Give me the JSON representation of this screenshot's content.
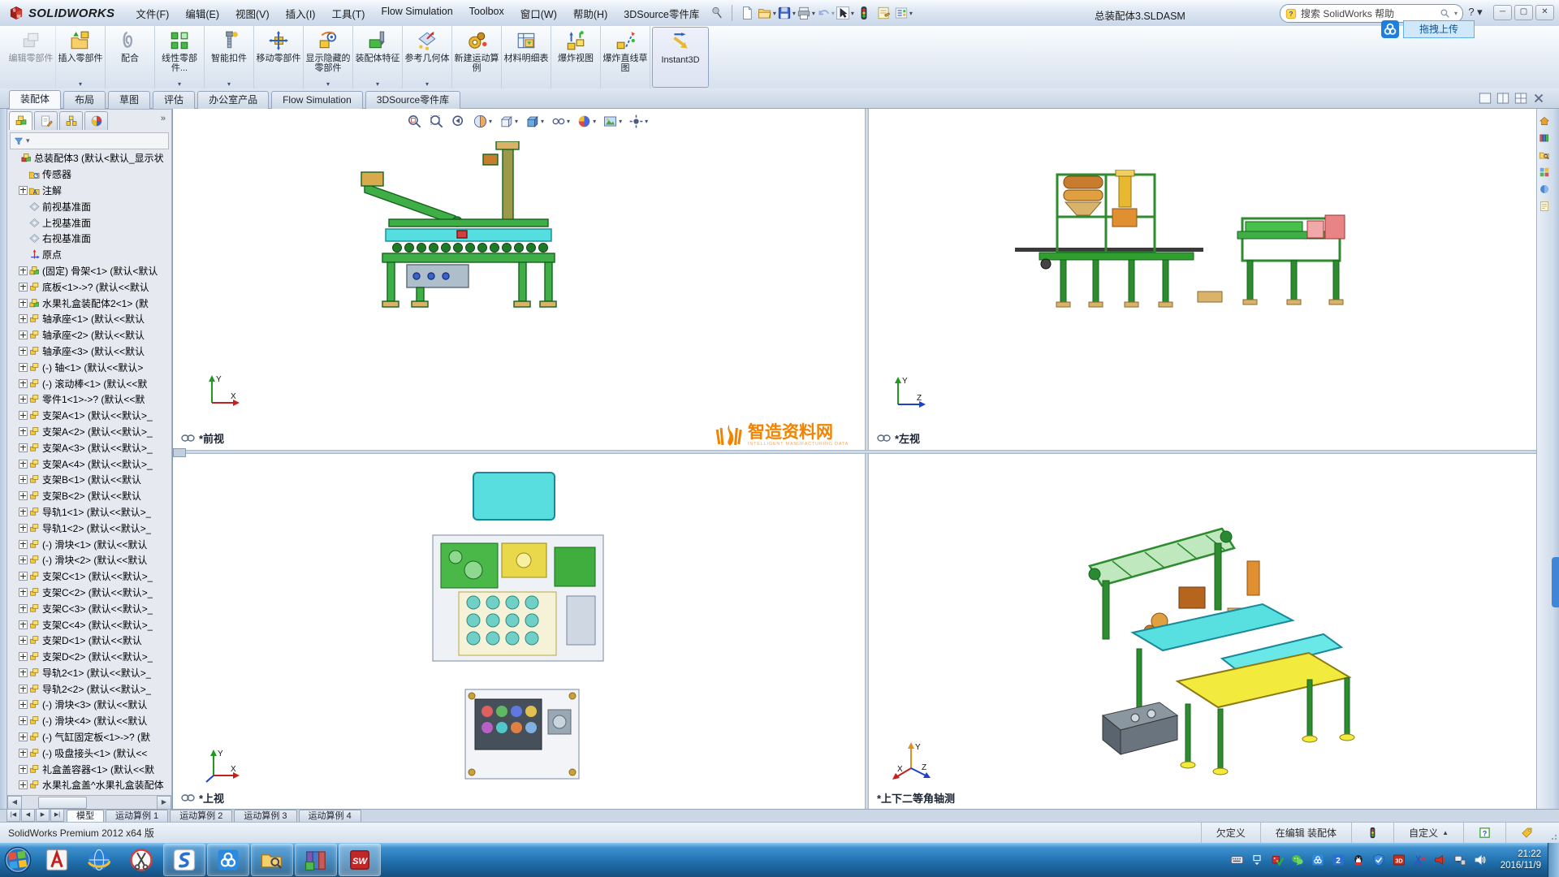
{
  "window": {
    "brand": "SOLIDWORKS",
    "title": "总装配体3.SLDASM",
    "search_placeholder": "搜索 SolidWorks 帮助",
    "controls": [
      "minimize",
      "maximize",
      "close"
    ]
  },
  "overlay": {
    "upload_label": "拖拽上传"
  },
  "menubar": {
    "items": [
      {
        "name": "file",
        "label": "文件(F)"
      },
      {
        "name": "edit",
        "label": "编辑(E)"
      },
      {
        "name": "view",
        "label": "视图(V)"
      },
      {
        "name": "insert",
        "label": "插入(I)"
      },
      {
        "name": "tools",
        "label": "工具(T)"
      },
      {
        "name": "flow-simulation",
        "label": "Flow Simulation"
      },
      {
        "name": "toolbox",
        "label": "Toolbox"
      },
      {
        "name": "window",
        "label": "窗口(W)"
      },
      {
        "name": "help",
        "label": "帮助(H)"
      },
      {
        "name": "3dsource",
        "label": "3DSource零件库"
      }
    ]
  },
  "quickbar": {
    "icons": [
      {
        "name": "pin"
      },
      {
        "name": "new-document"
      },
      {
        "name": "open",
        "caret": true
      },
      {
        "name": "save",
        "caret": true
      },
      {
        "name": "print",
        "caret": true
      },
      {
        "name": "undo",
        "caret": true,
        "disabled": true
      },
      {
        "name": "select-cursor",
        "caret": true
      },
      {
        "name": "traffic-light"
      },
      {
        "name": "file-properties"
      },
      {
        "name": "options",
        "caret": true
      }
    ]
  },
  "ribbon": {
    "buttons": [
      {
        "name": "edit-component",
        "label": "编辑零部件",
        "disabled": true
      },
      {
        "name": "insert-component",
        "label": "插入零部件",
        "dropdown": true
      },
      {
        "name": "mate",
        "label": "配合"
      },
      {
        "name": "linear-pattern",
        "label": "线性零部件...",
        "dropdown": true
      },
      {
        "name": "smart-fasteners",
        "label": "智能扣件",
        "dropdown": true
      },
      {
        "name": "move-component",
        "label": "移动零部件"
      },
      {
        "name": "show-hidden",
        "label": "显示隐藏的零部件",
        "dropdown": true
      },
      {
        "name": "assembly-features",
        "label": "装配体特征",
        "dropdown": true
      },
      {
        "name": "reference-geometry",
        "label": "参考几何体",
        "dropdown": true
      },
      {
        "name": "motion-study",
        "label": "新建运动算例"
      },
      {
        "name": "bom",
        "label": "材料明细表"
      },
      {
        "name": "exploded-view",
        "label": "爆炸视图"
      },
      {
        "name": "explode-sketch",
        "label": "爆炸直线草图"
      },
      {
        "name": "instant3d",
        "label": "Instant3D",
        "active": true
      }
    ]
  },
  "command_tabs": {
    "items": [
      {
        "label": "装配体",
        "active": true
      },
      {
        "label": "布局"
      },
      {
        "label": "草图"
      },
      {
        "label": "评估"
      },
      {
        "label": "办公室产品"
      },
      {
        "label": "Flow Simulation"
      },
      {
        "label": "3DSource零件库"
      }
    ]
  },
  "viewport_controls": {
    "icons": [
      {
        "name": "single-view"
      },
      {
        "name": "two-view"
      },
      {
        "name": "four-view"
      },
      {
        "name": "close-pane"
      }
    ]
  },
  "feature_panel": {
    "manager_tabs": [
      {
        "name": "featuremanager",
        "active": true
      },
      {
        "name": "propertymanager"
      },
      {
        "name": "configurationmanager"
      },
      {
        "name": "displaymanager"
      }
    ],
    "collapse_glyph": "»",
    "root": {
      "label": "总装配体3 (默认<默认_显示状"
    },
    "items": [
      {
        "icon": "sensors",
        "label": "传感器"
      },
      {
        "icon": "annotations",
        "label": "注解",
        "expand": true
      },
      {
        "icon": "plane",
        "label": "前视基准面"
      },
      {
        "icon": "plane",
        "label": "上视基准面"
      },
      {
        "icon": "plane",
        "label": "右视基准面"
      },
      {
        "icon": "origin",
        "label": "原点"
      },
      {
        "icon": "assembly",
        "label": "(固定) 骨架<1> (默认<默认",
        "expand": true
      },
      {
        "icon": "part",
        "label": "底板<1>->? (默认<<默认",
        "expand": true
      },
      {
        "icon": "assembly",
        "label": "水果礼盒装配体2<1> (默",
        "expand": true
      },
      {
        "icon": "part",
        "label": "轴承座<1> (默认<<默认",
        "expand": true
      },
      {
        "icon": "part",
        "label": "轴承座<2> (默认<<默认",
        "expand": true
      },
      {
        "icon": "part",
        "label": "轴承座<3> (默认<<默认",
        "expand": true
      },
      {
        "icon": "part",
        "label": "(-) 轴<1> (默认<<默认>",
        "expand": true
      },
      {
        "icon": "part",
        "label": "(-) 滚动棒<1> (默认<<默",
        "expand": true
      },
      {
        "icon": "part",
        "label": "零件1<1>->? (默认<<默",
        "expand": true
      },
      {
        "icon": "part",
        "label": "支架A<1> (默认<<默认>_",
        "expand": true
      },
      {
        "icon": "part",
        "label": "支架A<2> (默认<<默认>_",
        "expand": true
      },
      {
        "icon": "part",
        "label": "支架A<3> (默认<<默认>_",
        "expand": true
      },
      {
        "icon": "part",
        "label": "支架A<4> (默认<<默认>_",
        "expand": true
      },
      {
        "icon": "part",
        "label": "支架B<1> (默认<<默认",
        "expand": true
      },
      {
        "icon": "part",
        "label": "支架B<2> (默认<<默认",
        "expand": true
      },
      {
        "icon": "part",
        "label": "导轨1<1> (默认<<默认>_",
        "expand": true
      },
      {
        "icon": "part",
        "label": "导轨1<2> (默认<<默认>_",
        "expand": true
      },
      {
        "icon": "part",
        "label": "(-) 滑块<1> (默认<<默认",
        "expand": true
      },
      {
        "icon": "part",
        "label": "(-) 滑块<2> (默认<<默认",
        "expand": true
      },
      {
        "icon": "part",
        "label": "支架C<1> (默认<<默认>_",
        "expand": true
      },
      {
        "icon": "part",
        "label": "支架C<2> (默认<<默认>_",
        "expand": true
      },
      {
        "icon": "part",
        "label": "支架C<3> (默认<<默认>_",
        "expand": true
      },
      {
        "icon": "part",
        "label": "支架C<4> (默认<<默认>_",
        "expand": true
      },
      {
        "icon": "part",
        "label": "支架D<1> (默认<<默认",
        "expand": true
      },
      {
        "icon": "part",
        "label": "支架D<2> (默认<<默认>_",
        "expand": true
      },
      {
        "icon": "part",
        "label": "导轨2<1> (默认<<默认>_",
        "expand": true
      },
      {
        "icon": "part",
        "label": "导轨2<2> (默认<<默认>_",
        "expand": true
      },
      {
        "icon": "part",
        "label": "(-) 滑块<3> (默认<<默认",
        "expand": true
      },
      {
        "icon": "part",
        "label": "(-) 滑块<4> (默认<<默认",
        "expand": true
      },
      {
        "icon": "part",
        "label": "(-) 气缸固定板<1>->? (默",
        "expand": true
      },
      {
        "icon": "part",
        "label": "(-) 吸盘接头<1> (默认<<",
        "expand": true
      },
      {
        "icon": "part",
        "label": "礼盒盖容器<1> (默认<<默",
        "expand": true
      },
      {
        "icon": "part",
        "label": "水果礼盒盖^水果礼盒装配体",
        "expand": true
      }
    ]
  },
  "headsup": {
    "icons": [
      {
        "name": "zoom-fit"
      },
      {
        "name": "zoom-to-area"
      },
      {
        "name": "previous-view"
      },
      {
        "name": "section-view",
        "caret": true
      },
      {
        "name": "view-orientation",
        "caret": true
      },
      {
        "name": "display-style",
        "caret": true
      },
      {
        "name": "hide-show-items",
        "caret": true
      },
      {
        "name": "edit-appearance",
        "caret": true
      },
      {
        "name": "apply-scene",
        "caret": true
      },
      {
        "name": "view-settings",
        "caret": true
      }
    ]
  },
  "task_pane": {
    "icons": [
      {
        "name": "solidworks-resources"
      },
      {
        "name": "design-library"
      },
      {
        "name": "file-explorer"
      },
      {
        "name": "view-palette"
      },
      {
        "name": "appearances-scenes"
      },
      {
        "name": "custom-properties"
      }
    ]
  },
  "viewports": [
    {
      "label": "*前视",
      "linked": true,
      "axes": [
        {
          "axis": "Y",
          "dir": "up"
        },
        {
          "axis": "X",
          "dir": "right"
        }
      ]
    },
    {
      "label": "*左视",
      "linked": true,
      "axes": [
        {
          "axis": "Y",
          "dir": "up"
        },
        {
          "axis": "Z",
          "dir": "right"
        }
      ]
    },
    {
      "label": "*上视",
      "linked": true,
      "axes": [
        {
          "axis": "Y",
          "dir": "up"
        },
        {
          "axis": "X",
          "dir": "right"
        },
        {
          "axis": "Z",
          "dir": "downleft"
        }
      ]
    },
    {
      "label": "*上下二等角轴测",
      "linked": false,
      "axes": [
        {
          "axis": "Y",
          "dir": "up"
        },
        {
          "axis": "X",
          "dir": "downleft"
        },
        {
          "axis": "Z",
          "dir": "downright"
        }
      ]
    }
  ],
  "watermark": {
    "title": "智造资料网",
    "subtitle": "INTELLIGENT MANUFACTURING DATA"
  },
  "model_tabs": {
    "nav": [
      "|◀",
      "◀",
      "▶",
      "▶|"
    ],
    "items": [
      {
        "label": "模型",
        "active": true
      },
      {
        "label": "运动算例 1"
      },
      {
        "label": "运动算例 2"
      },
      {
        "label": "运动算例 3"
      },
      {
        "label": "运动算例 4"
      }
    ]
  },
  "statusbar": {
    "left": "SolidWorks Premium 2012 x64 版",
    "fields": [
      {
        "label": "欠定义"
      },
      {
        "label": "在编辑 装配体"
      },
      {
        "icon": "traffic-light"
      },
      {
        "label": "自定义",
        "caret": true
      },
      {
        "icon": "help-question"
      },
      {
        "icon": "tag"
      }
    ]
  },
  "taskbar": {
    "apps": [
      {
        "name": "windows-start"
      },
      {
        "name": "autocad"
      },
      {
        "name": "browser-globe"
      },
      {
        "name": "screenshot-tool"
      },
      {
        "name": "sogou-browser",
        "running": true
      },
      {
        "name": "baidu-cloud",
        "running": true
      },
      {
        "name": "file-explorer",
        "running": true
      },
      {
        "name": "winrar",
        "running": true
      },
      {
        "name": "solidworks",
        "running": true,
        "current": true
      }
    ],
    "tray": [
      {
        "name": "keyboard"
      },
      {
        "name": "show-hidden-icons"
      },
      {
        "name": "antivirus-dice"
      },
      {
        "name": "wechat"
      },
      {
        "name": "baidu-cloud-tray"
      },
      {
        "name": "sogou-input"
      },
      {
        "name": "qq"
      },
      {
        "name": "security-shield"
      },
      {
        "name": "3dsource-tray"
      },
      {
        "name": "cut-disabled"
      },
      {
        "name": "red-horn"
      },
      {
        "name": "network"
      },
      {
        "name": "volume"
      }
    ],
    "clock": {
      "time": "21:22",
      "date": "2016/11/9"
    }
  },
  "colors": {
    "accent_blue": "#2b7cd3",
    "taskbar_blue": "#2070ae",
    "watermark_orange": "#f08300",
    "tree_part_yellow": "#f3c93c",
    "model_green": "#3fae46",
    "model_cyan": "#55dede",
    "model_table_yellow": "#f2ea3c",
    "pane_tab_blue": "#3f86d8"
  }
}
